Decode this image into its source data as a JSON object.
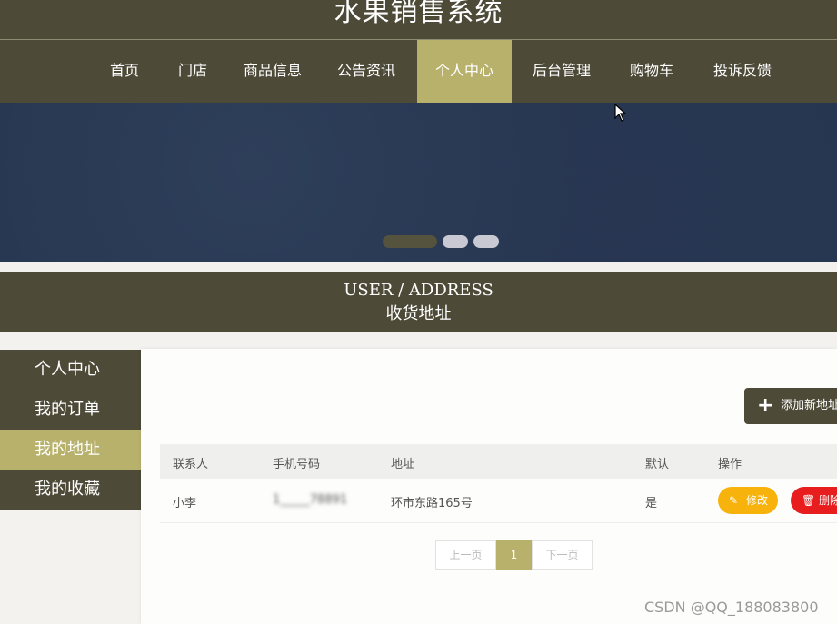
{
  "header": {
    "title": "水果销售系统"
  },
  "nav": {
    "items": [
      {
        "label": "首页"
      },
      {
        "label": "门店"
      },
      {
        "label": "商品信息"
      },
      {
        "label": "公告资讯"
      },
      {
        "label": "个人中心"
      },
      {
        "label": "后台管理"
      },
      {
        "label": "购物车"
      },
      {
        "label": "投诉反馈"
      }
    ],
    "active": "个人中心"
  },
  "banner": {
    "dots": 3,
    "active_dot": 1
  },
  "section": {
    "title_en": "USER / ADDRESS",
    "title_zh": "收货地址"
  },
  "sidebar": {
    "items": [
      {
        "label": "个人中心"
      },
      {
        "label": "我的订单"
      },
      {
        "label": "我的地址"
      },
      {
        "label": "我的收藏"
      }
    ],
    "active": "我的地址"
  },
  "toolbar": {
    "add_label": "添加新地址"
  },
  "table": {
    "headers": [
      "联系人",
      "手机号码",
      "地址",
      "默认",
      "操作"
    ],
    "rows": [
      {
        "contact": "小李",
        "phone": "1_____78891",
        "address": "环市东路165号",
        "default": "是",
        "edit": "修改",
        "delete": "删除"
      }
    ]
  },
  "pagination": {
    "prev": "上一页",
    "current": "1",
    "next": "下一页"
  },
  "watermark": "CSDN @QQ_188083800",
  "colors": {
    "primary": "#4d4a38",
    "accent": "#b7b16c",
    "edit": "#f7b30c",
    "delete": "#e81d1d",
    "banner": "#273650"
  }
}
